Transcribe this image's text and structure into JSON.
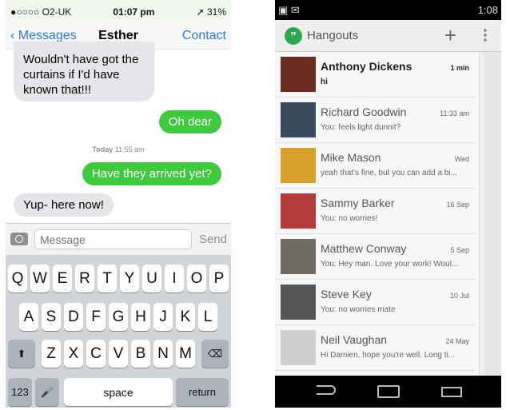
{
  "ios": {
    "status": {
      "carrier": "●○○○○ O2-UK",
      "wifi": "wifi-icon",
      "time": "01:07 pm",
      "battery": "➚ 31%"
    },
    "nav": {
      "back": "Messages",
      "title": "Esther",
      "contact": "Contact"
    },
    "messages": [
      {
        "dir": "in",
        "text": "Wouldn't have got the curtains if I'd have known that!!!"
      },
      {
        "dir": "out",
        "text": "Oh dear"
      },
      {
        "dir": "out",
        "text": "Have they arrived yet?"
      },
      {
        "dir": "in",
        "text": "Yup- here now!"
      }
    ],
    "timestamp": {
      "day": "Today",
      "time": "11:55 am"
    },
    "input": {
      "placeholder": "Message",
      "send": "Send"
    },
    "keyboard": {
      "row1": [
        "Q",
        "W",
        "E",
        "R",
        "T",
        "Y",
        "U",
        "I",
        "O",
        "P"
      ],
      "row2": [
        "A",
        "S",
        "D",
        "F",
        "G",
        "H",
        "J",
        "K",
        "L"
      ],
      "row3": [
        "Z",
        "X",
        "C",
        "V",
        "B",
        "N",
        "M"
      ],
      "shift": "⬆",
      "delete": "⌫",
      "numbers": "123",
      "mic": "🎤",
      "space": "space",
      "return": "return"
    },
    "colors": {
      "blue": "#2a7ae2",
      "green": "#3ec93e",
      "gray_bubble": "#e5e5ea"
    }
  },
  "android": {
    "status": {
      "time": "1:08"
    },
    "app_title": "Hangouts",
    "plus": "+",
    "conversations": [
      {
        "name": "Anthony Dickens",
        "time": "1 min",
        "preview": "hi",
        "unread": true,
        "avatar_color": "#6b2a22"
      },
      {
        "name": "Richard Goodwin",
        "time": "11:33 am",
        "preview": "You: feels light dunnit?",
        "avatar_color": "#3a4a5e"
      },
      {
        "name": "Mike Mason",
        "time": "Wed",
        "preview": "yeah that's fine, but you can add a bi...",
        "avatar_color": "#d9a12a"
      },
      {
        "name": "Sammy Barker",
        "time": "16 Sep",
        "preview": "You: no worries!",
        "avatar_color": "#b33a3a"
      },
      {
        "name": "Matthew Conway",
        "time": "5 Sep",
        "preview": "You: Hey man. Love your work! Woul...",
        "avatar_color": "#6f6a62"
      },
      {
        "name": "Steve Key",
        "time": "10 Jul",
        "preview": "You: no worries mate",
        "avatar_color": "#555555"
      },
      {
        "name": "Neil Vaughan",
        "time": "24 May",
        "preview": "Hi Damien, hope you're well. Long ti...",
        "avatar_color": "#cfcfcf"
      }
    ],
    "colors": {
      "hangouts_green": "#2fa84f"
    }
  }
}
